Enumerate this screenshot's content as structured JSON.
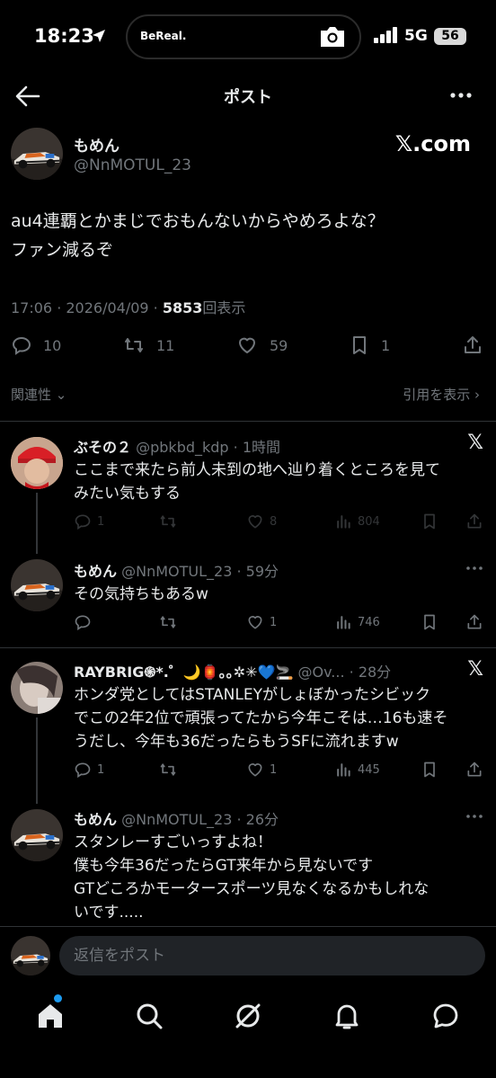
{
  "status_bar": {
    "time": "18:23",
    "island_label": "BeReal.",
    "network": "5G",
    "battery": "56"
  },
  "header": {
    "title": "ポスト"
  },
  "post": {
    "author_name": "もめん",
    "author_handle": "@NnMOTUL_23",
    "source": "𝕏.com",
    "text_line1": "au4連覇とかまじでおもんないからやめろよな？",
    "text_line2": "ファン減るぞ",
    "time": "17:06 · 2026/04/09 · ",
    "views_count": "5853",
    "views_label": "回表示",
    "replies": "10",
    "reposts": "11",
    "likes": "59",
    "bookmarks": "1"
  },
  "links": {
    "related": "関連性",
    "quotes": "引用を表示"
  },
  "replies": [
    {
      "name": "ぶその２",
      "handle": "@pbkbd_kdp · 1時間",
      "line1": "ここまで来たら前人未到の地へ辿り着くところを見て",
      "line2": "みたい気もする",
      "replies": "1",
      "likes": "8",
      "views": "804"
    },
    {
      "name": "もめん",
      "handle": "@NnMOTUL_23 · 59分",
      "line1": "その気持ちもあるw",
      "replies": "",
      "likes": "1",
      "views": "746"
    },
    {
      "name": "RAYBRIG֍*.゜🌙🏮｡｡✲✳💙🚬",
      "handle": "@Ov... · 28分",
      "line1": "ホンダ党としてはSTANLEYがしょぼかったシビック",
      "line2": "でこの2年2位で頑張ってたから今年こそは…16も速そ",
      "line3": "うだし、今年も36だったらもうSFに流れますw",
      "replies": "1",
      "likes": "1",
      "views": "445"
    },
    {
      "name": "もめん",
      "handle": "@NnMOTUL_23 · 26分",
      "line1": "スタンレーすごいっすよね！",
      "line2": "僕も今年36だったらGT来年から見ないです",
      "line3": "GTどころかモータースポーツ見なくなるかもしれな",
      "line4": "いです.....",
      "replies": "",
      "likes": "",
      "views": ""
    }
  ],
  "composer": {
    "placeholder": "返信をポスト"
  },
  "colors": {
    "background": "#000000",
    "text": "#e7e9ea",
    "muted": "#71767b",
    "accent": "#1d9bf0"
  },
  "icons": [
    "back-arrow-icon",
    "more-icon",
    "reply-icon",
    "repost-icon",
    "like-icon",
    "bookmark-icon",
    "share-icon",
    "views-icon",
    "home-icon",
    "search-icon",
    "grok-icon",
    "bell-icon",
    "messages-icon"
  ]
}
